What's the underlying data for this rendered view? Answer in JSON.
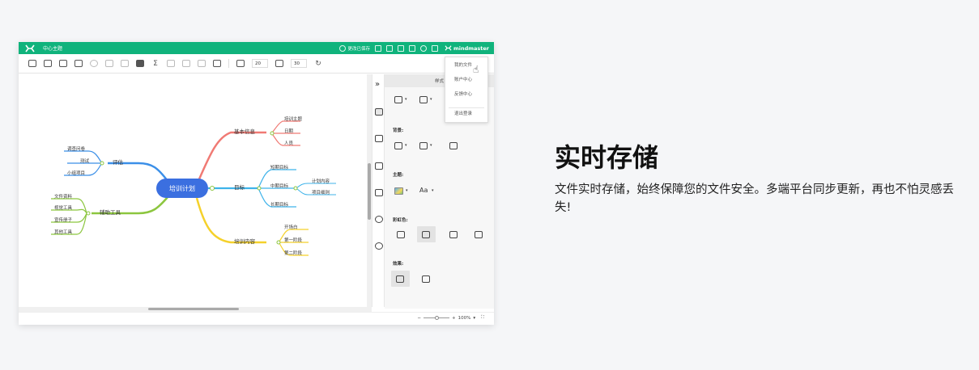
{
  "app": {
    "doc_title": "中心主题",
    "saved_status": "更改已保存",
    "brand": "mindmaster",
    "toolbar": {
      "spacing_h": "20",
      "spacing_v": "30"
    },
    "panel_tab": "样式",
    "menu": {
      "items": [
        "我的文件",
        "账户中心",
        "反馈中心",
        "退出登录"
      ]
    },
    "style_panel": {
      "background_label": "背景:",
      "theme_label": "主题:",
      "font_glyph": "Aa",
      "rainbow_label": "彩虹色:",
      "effect_label": "效果:"
    },
    "zoom": "100%",
    "mindmap": {
      "root": "培训计划",
      "branches": [
        {
          "name": "基本信息",
          "color": "#f07a74",
          "leaves": [
            "培训主题",
            "日期",
            "人员"
          ]
        },
        {
          "name": "目标",
          "color": "#3fb3ea",
          "leaves": [
            "短期目标",
            "中期目标",
            "长期目标"
          ],
          "sub": [
            "计划内容",
            "项目细则"
          ]
        },
        {
          "name": "培训内容",
          "color": "#f5d12b",
          "leaves": [
            "开场白",
            "第一阶段",
            "第二阶段"
          ]
        },
        {
          "name": "评估",
          "color": "#3b8fe8",
          "leaves": [
            "调查问卷",
            "测试",
            "小组项目"
          ]
        },
        {
          "name": "辅助工具",
          "color": "#8cc63f",
          "leaves": [
            "文件资料",
            "视觉工具",
            "宣传册子",
            "其他工具"
          ]
        }
      ]
    }
  },
  "feature": {
    "title": "实时存储",
    "description": "文件实时存储，始终保障您的文件安全。多端平台同步更新，再也不怕灵感丢失!"
  }
}
